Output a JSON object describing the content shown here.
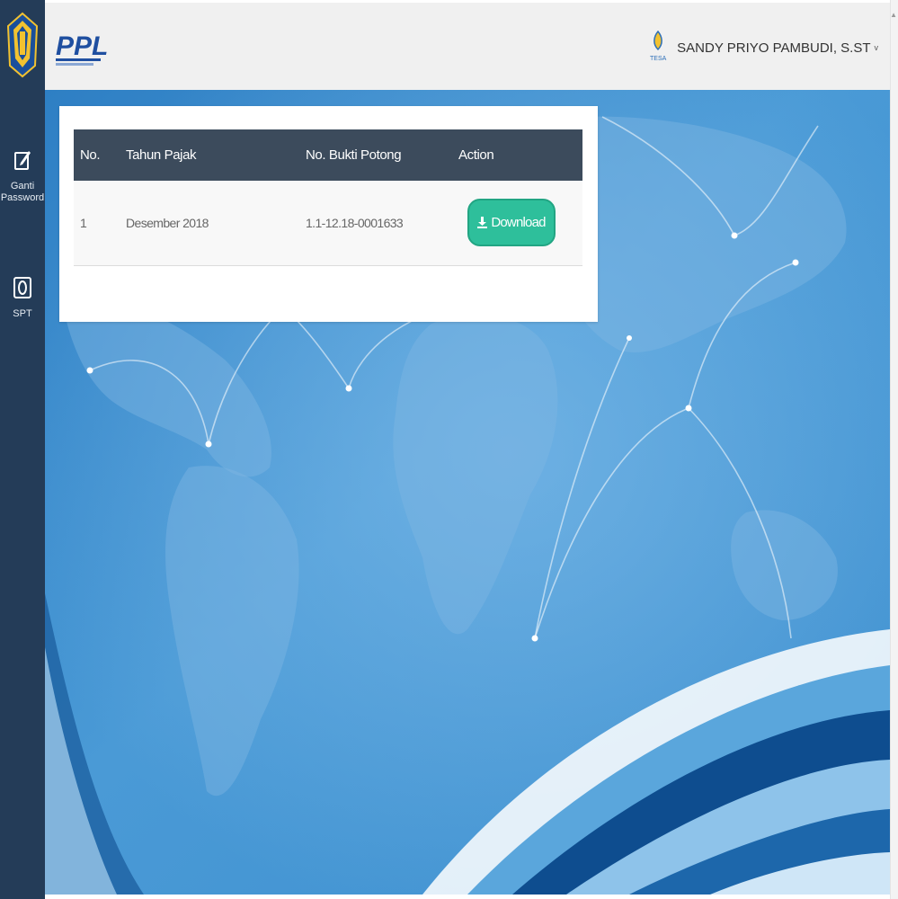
{
  "user": {
    "name": "SANDY PRIYO PAMBUDI, S.ST",
    "caret": "v",
    "badge_text": "TESA"
  },
  "app": {
    "logo_text": "PPL"
  },
  "sidebar": {
    "items": [
      {
        "label": "Ganti Password",
        "icon": "edit-icon"
      },
      {
        "label": "SPT",
        "icon": "document-icon"
      }
    ]
  },
  "table": {
    "headers": [
      "No.",
      "Tahun Pajak",
      "No. Bukti Potong",
      "Action"
    ],
    "rows": [
      {
        "no": "1",
        "tahun": "Desember 2018",
        "bukti": "1.1-12.18-0001633",
        "action": "Download"
      }
    ]
  },
  "colors": {
    "sidebar": "#243c58",
    "table_header": "#3c4b5c",
    "download_button": "#2ebf9b",
    "background_blue": "#3b8fcf"
  }
}
